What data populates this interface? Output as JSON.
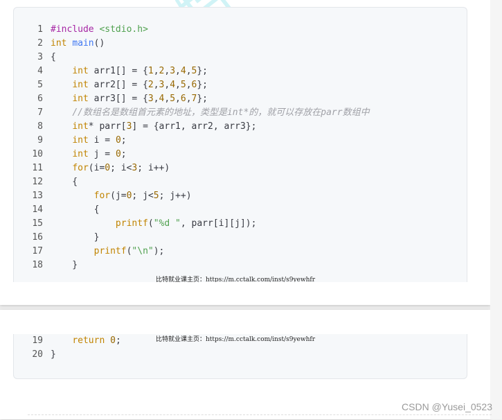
{
  "watermark_glyph": "比特",
  "source_note": "比特就业课主页：https://m.cctalk.com/inst/s9yewhfr",
  "csdn_credit": "CSDN @Yusei_0523",
  "code": {
    "ln": [
      "1",
      "2",
      "3",
      "4",
      "5",
      "6",
      "7",
      "8",
      "9",
      "10",
      "11",
      "12",
      "13",
      "14",
      "15",
      "16",
      "17",
      "18",
      "19",
      "20"
    ],
    "t": {
      "l1a": "#include ",
      "l1b": "<stdio.h>",
      "l2a": "int",
      "l2b": " ",
      "l2c": "main",
      "l2d": "()",
      "l3a": "{",
      "l4a": "    ",
      "l4b": "int",
      "l4c": " arr1[] = {",
      "l4n1": "1",
      "l4s1": ",",
      "l4n2": "2",
      "l4s2": ",",
      "l4n3": "3",
      "l4s3": ",",
      "l4n4": "4",
      "l4s4": ",",
      "l4n5": "5",
      "l4e": "};",
      "l5a": "    ",
      "l5b": "int",
      "l5c": " arr2[] = {",
      "l5n1": "2",
      "l5s1": ",",
      "l5n2": "3",
      "l5s2": ",",
      "l5n3": "4",
      "l5s3": ",",
      "l5n4": "5",
      "l5s4": ",",
      "l5n5": "6",
      "l5e": "};",
      "l6a": "    ",
      "l6b": "int",
      "l6c": " arr3[] = {",
      "l6n1": "3",
      "l6s1": ",",
      "l6n2": "4",
      "l6s2": ",",
      "l6n3": "5",
      "l6s3": ",",
      "l6n4": "6",
      "l6s4": ",",
      "l6n5": "7",
      "l6e": "};",
      "l7a": "    ",
      "l7b": "//数组名是数组首元素的地址，类型是int*的，就可以存放在parr数组中",
      "l8a": "    ",
      "l8b": "int",
      "l8c": "* parr[",
      "l8n": "3",
      "l8d": "] = {arr1, arr2, arr3};",
      "l9a": "    ",
      "l9b": "int",
      "l9c": " i = ",
      "l9n": "0",
      "l9d": ";",
      "l10a": "    ",
      "l10b": "int",
      "l10c": " j = ",
      "l10n": "0",
      "l10d": ";",
      "l11a": "    ",
      "l11b": "for",
      "l11c": "(i=",
      "l11n1": "0",
      "l11d": "; i<",
      "l11n2": "3",
      "l11e": "; i++)",
      "l12a": "    {",
      "l13a": "        ",
      "l13b": "for",
      "l13c": "(j=",
      "l13n1": "0",
      "l13d": "; j<",
      "l13n2": "5",
      "l13e": "; j++)",
      "l14a": "        {",
      "l15a": "            ",
      "l15b": "printf",
      "l15c": "(",
      "l15s": "\"%d \"",
      "l15d": ", parr[i][j]);",
      "l16a": "        }",
      "l17a": "        ",
      "l17b": "printf",
      "l17c": "(",
      "l17s": "\"\\n\"",
      "l17d": ");",
      "l18a": "    }",
      "l19a": "    ",
      "l19b": "return",
      "l19c": " ",
      "l19n": "0",
      "l19d": ";",
      "l20a": "}"
    }
  }
}
